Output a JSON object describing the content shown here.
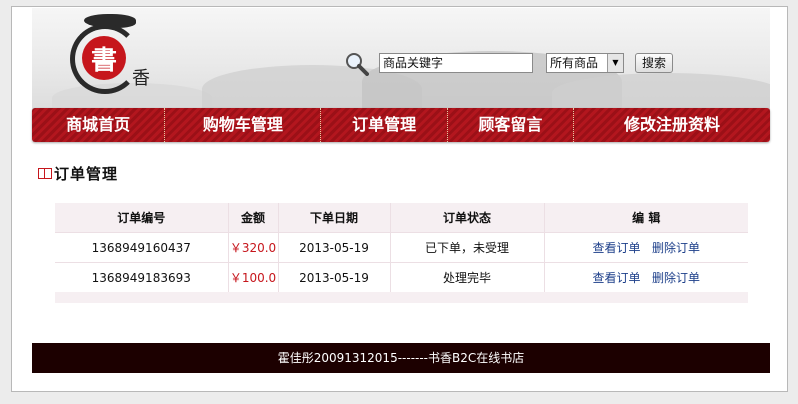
{
  "logo": {
    "seal_char": "書",
    "side_char": "香"
  },
  "search": {
    "input_value": "商品关键字",
    "category": "所有商品",
    "button_label": "搜索"
  },
  "nav": {
    "items": [
      {
        "label": "商城首页"
      },
      {
        "label": "购物车管理"
      },
      {
        "label": "订单管理"
      },
      {
        "label": "顾客留言"
      },
      {
        "label": "修改注册资料"
      }
    ]
  },
  "section": {
    "title": "订单管理"
  },
  "orders": {
    "columns": [
      "订单编号",
      "金额",
      "下单日期",
      "订单状态",
      "编 辑"
    ],
    "rows": [
      {
        "id": "1368949160437",
        "amount": "￥320.0",
        "date": "2013-05-19",
        "status": "已下单，未受理",
        "view": "查看订单",
        "delete": "删除订单"
      },
      {
        "id": "1368949183693",
        "amount": "￥100.0",
        "date": "2013-05-19",
        "status": "处理完毕",
        "view": "查看订单",
        "delete": "删除订单"
      }
    ]
  },
  "footer": {
    "text": "霍佳彤20091312015-------书香B2C在线书店"
  },
  "colors": {
    "brand_red": "#c6161c",
    "footer_bg": "#1c0000",
    "link": "#1d3f8a"
  }
}
